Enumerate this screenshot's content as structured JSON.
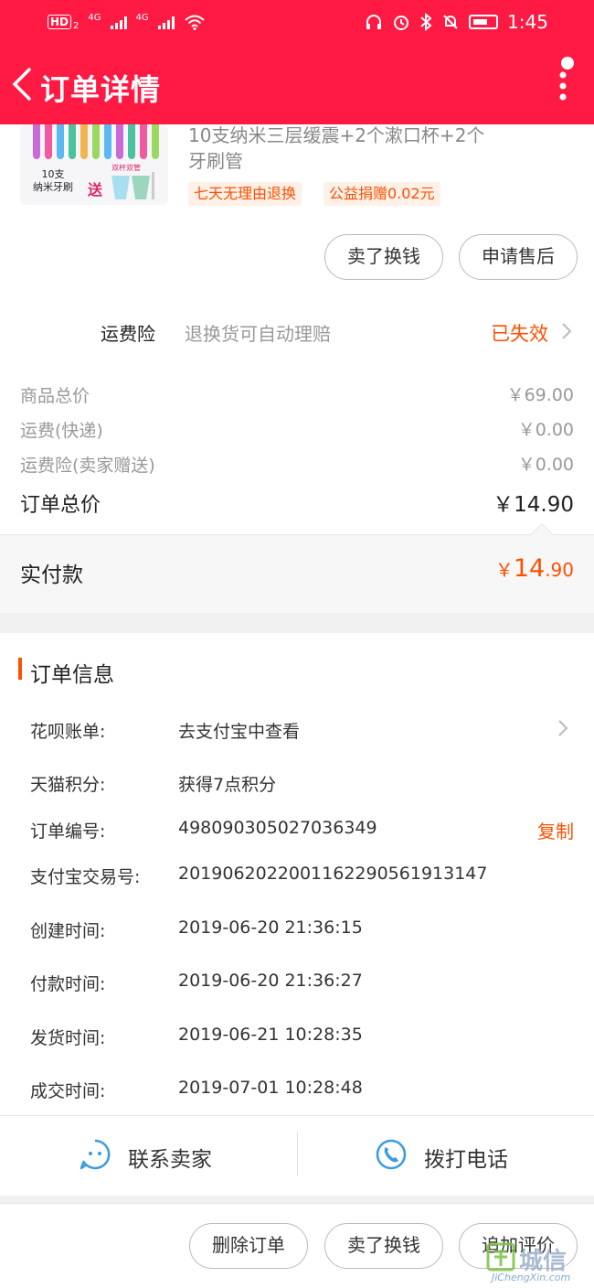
{
  "status_bar": {
    "hd_label": "HD",
    "hd_sub": "2",
    "net1": "4G",
    "net2": "4G",
    "time": "1:45"
  },
  "header": {
    "title": "订单详情"
  },
  "product": {
    "thumb_label": "10支\n纳米牙刷",
    "thumb_gift": "送",
    "thumb_cups_label": "双杯双管",
    "title": "10支纳米三层缓震+2个漱口杯+2个牙刷管",
    "tags": [
      "七天无理由退换",
      "公益捐赠0.02元"
    ],
    "buttons": [
      "卖了换钱",
      "申请售后"
    ]
  },
  "insurance": {
    "label": "运费险",
    "desc": "退换货可自动理赔",
    "status": "已失效"
  },
  "price_rows": [
    {
      "label": "商品总价",
      "value": "￥69.00"
    },
    {
      "label": "运费(快递)",
      "value": "￥0.00"
    },
    {
      "label": "运费险(卖家赠送)",
      "value": "￥0.00"
    }
  ],
  "order_total": {
    "label": "订单总价",
    "value": "￥14.90"
  },
  "paid": {
    "label": "实付款",
    "currency": "￥",
    "int": "14",
    "dec": ".90"
  },
  "order_info": {
    "title": "订单信息",
    "rows": [
      {
        "label": "花呗账单:",
        "value": "去支付宝中查看"
      },
      {
        "label": "天猫积分:",
        "value": "获得7点积分"
      },
      {
        "label": "订单编号:",
        "value": "498090305027036349",
        "action": "复制"
      },
      {
        "label": "支付宝交易号:",
        "value": "2019062022001162290561913147"
      },
      {
        "label": "创建时间:",
        "value": "2019-06-20 21:36:15"
      },
      {
        "label": "付款时间:",
        "value": "2019-06-20 21:36:27"
      },
      {
        "label": "发货时间:",
        "value": "2019-06-21 10:28:35"
      },
      {
        "label": "成交时间:",
        "value": "2019-07-01 10:28:48"
      }
    ]
  },
  "contact": {
    "seller": "联系卖家",
    "phone": "拨打电话"
  },
  "bottom_buttons": [
    "删除订单",
    "卖了换钱",
    "追加评价"
  ],
  "watermark": {
    "text": "城信",
    "sub": "JiChengXin.com"
  },
  "colors": {
    "brand": "#ff1a44",
    "accent": "#ff5000",
    "link": "#3a9be0"
  }
}
